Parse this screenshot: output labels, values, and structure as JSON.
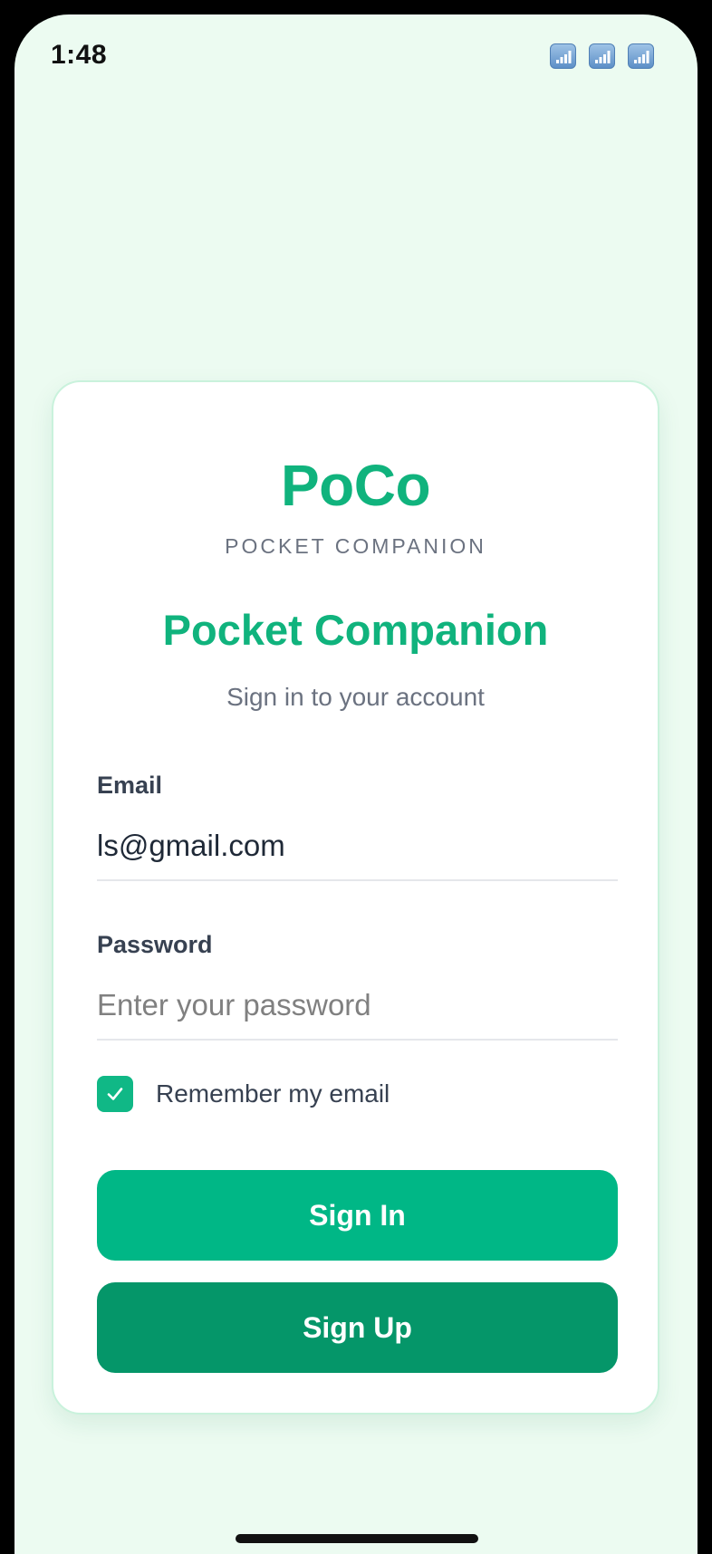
{
  "status_bar": {
    "time": "1:48",
    "icons": [
      "signal-icon",
      "signal-icon",
      "signal-icon"
    ]
  },
  "brand": {
    "logo_text": "PoCo",
    "tagline": "POCKET COMPANION"
  },
  "header": {
    "title": "Pocket Companion",
    "subtitle": "Sign in to your account"
  },
  "form": {
    "email_label": "Email",
    "email_value": "ls@gmail.com",
    "password_label": "Password",
    "password_placeholder": "Enter your password",
    "password_value": "",
    "remember_label": "Remember my email",
    "remember_checked": true
  },
  "buttons": {
    "sign_in": "Sign In",
    "sign_up": "Sign Up"
  },
  "colors": {
    "accent": "#10b37d",
    "primary_button": "#00b786",
    "secondary_button": "#059669",
    "background": "#ecfbf1",
    "card_border": "#c9f2dc"
  }
}
